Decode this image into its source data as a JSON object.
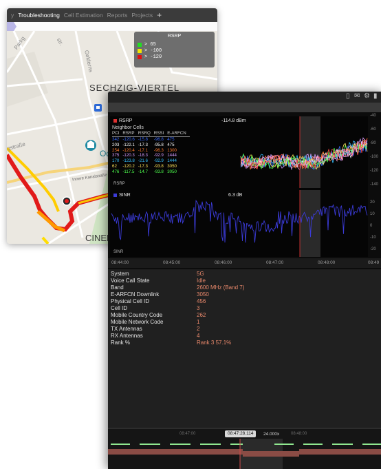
{
  "map_window": {
    "tabs": [
      {
        "label": "y",
        "active": false
      },
      {
        "label": "Troubleshooting",
        "active": true
      },
      {
        "label": "Cell Estimation",
        "active": false
      },
      {
        "label": "Reports",
        "active": false
      },
      {
        "label": "Projects",
        "active": false
      }
    ],
    "add_tab": "+",
    "legend": {
      "title": "RSRP",
      "rows": [
        {
          "label": "> 65",
          "color": "#22dd22"
        },
        {
          "label": "> -100",
          "color": "#f2e600"
        },
        {
          "label": "> -120",
          "color": "#e01010"
        }
      ]
    },
    "labels": {
      "district": "SECHZIG-VIERTEL",
      "poi": "Od",
      "bottom": "CINEDO",
      "street_1": "Gelderns",
      "street_2": "str.",
      "street_3": "Parkg",
      "street_4": "gstraße",
      "road": "Innere Kanalstraße"
    }
  },
  "analyzer": {
    "rsrp": {
      "title": "RSRP",
      "value": "-114.8 dBm",
      "color": "#e03030",
      "y_ticks": [
        "-40",
        "-60",
        "-80",
        "-100",
        "-120",
        "-140"
      ],
      "neighbor_title": "Neighbor Cells",
      "neighbor_columns": [
        "PCI",
        "RSRP",
        "RSRQ",
        "RSSI",
        "E-ARFCN"
      ],
      "neighbor_rows": [
        {
          "pci": "342",
          "rsrp": "-120.6",
          "rsrq": "-15.8",
          "rssi": "-96.8",
          "earfcn": "475",
          "color": "#3b6bff"
        },
        {
          "pci": "203",
          "rsrp": "-122.1",
          "rsrq": "-17.3",
          "rssi": "-95.8",
          "earfcn": "475",
          "color": "#ffffff"
        },
        {
          "pci": "254",
          "rsrp": "-120.4",
          "rsrq": "-17.1",
          "rssi": "-96.3",
          "earfcn": "1300",
          "color": "#ff7a2e"
        },
        {
          "pci": "375",
          "rsrp": "-120.3",
          "rsrq": "-18.3",
          "rssi": "-92.9",
          "earfcn": "1444",
          "color": "#d59bff"
        },
        {
          "pci": "170",
          "rsrp": "-123.8",
          "rsrq": "-21.6",
          "rssi": "-92.9",
          "earfcn": "1444",
          "color": "#35c0ff"
        },
        {
          "pci": "62",
          "rsrp": "-120.2",
          "rsrq": "-17.3",
          "rssi": "-93.8",
          "earfcn": "3050",
          "color": "#ffe35a"
        },
        {
          "pci": "476",
          "rsrp": "-117.5",
          "rsrq": "-14.7",
          "rssi": "-93.8",
          "earfcn": "3050",
          "color": "#4dff4d"
        }
      ],
      "bottom_label": "RSRP"
    },
    "sinr": {
      "title": "SINR",
      "value": "6.3 dB",
      "color": "#3b3bd8",
      "y_ticks": [
        "20",
        "10",
        "0",
        "-10",
        "-20"
      ],
      "bottom_label": "SINR"
    },
    "time_axis": [
      "08:44:00",
      "08:45:00",
      "08:46:00",
      "08:47:00",
      "08:48:00",
      "08:49"
    ],
    "info": [
      {
        "key": "System",
        "value": "5G"
      },
      {
        "key": "Voice Call State",
        "value": "Idle"
      },
      {
        "key": "Band",
        "value": "2600 MHz (Band 7)"
      },
      {
        "key": "E-ARFCN Downlink",
        "value": "3050"
      },
      {
        "key": "Physical Cell ID",
        "value": "456"
      },
      {
        "key": "Cell ID",
        "value": "3"
      },
      {
        "key": "Mobile Country Code",
        "value": "262"
      },
      {
        "key": "Mobile Network Code",
        "value": "1"
      },
      {
        "key": "TX Antennas",
        "value": "2"
      },
      {
        "key": "RX Antennas",
        "value": "4"
      },
      {
        "key": "Rank %",
        "value": "Rank 3 57.1%"
      }
    ],
    "timeline": {
      "labels": [
        "08:47:00",
        "08:48:00"
      ],
      "cursor": "08:47:28.114",
      "speed": "24.000x"
    }
  }
}
